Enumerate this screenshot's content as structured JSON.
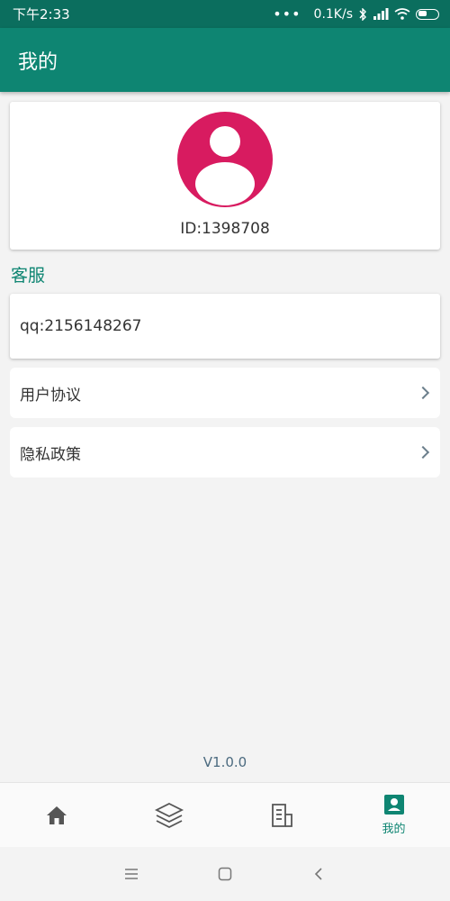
{
  "status_bar": {
    "time": "下午2:33",
    "dots": "•••",
    "network_speed": "0.1K/s",
    "icons": [
      "bluetooth-icon",
      "signal-icon",
      "wifi-icon",
      "battery-icon"
    ]
  },
  "app_bar": {
    "title": "我的"
  },
  "profile": {
    "avatar_icon": "person-avatar-icon",
    "avatar_color": "#d81b60",
    "user_id": "ID:1398708"
  },
  "customer_service": {
    "section_label": "客服",
    "qq": "qq:2156148267"
  },
  "menu": {
    "items": [
      {
        "label": "用户协议",
        "icon": "chevron-right-icon"
      },
      {
        "label": "隐私政策",
        "icon": "chevron-right-icon"
      }
    ]
  },
  "version": "V1.0.0",
  "bottom_nav": {
    "items": [
      {
        "icon": "home-icon",
        "label": ""
      },
      {
        "icon": "layers-icon",
        "label": ""
      },
      {
        "icon": "document-icon",
        "label": ""
      },
      {
        "icon": "profile-icon",
        "label": "我的",
        "active": true
      }
    ]
  },
  "system_nav": {
    "icons": [
      "menu-icon",
      "home-square-icon",
      "back-icon"
    ]
  },
  "colors": {
    "primary": "#0e8572",
    "status_bar": "#0b6e5e",
    "avatar": "#d81b60",
    "background": "#f3f3f3"
  }
}
